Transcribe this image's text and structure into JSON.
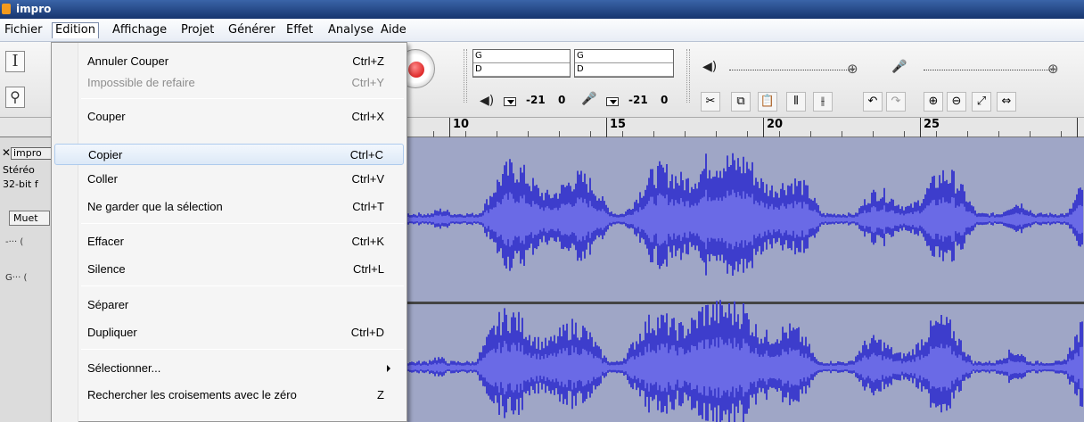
{
  "window": {
    "title": "impro"
  },
  "menubar": {
    "items": [
      "Fichier",
      "Edition",
      "Affichage",
      "Projet",
      "Générer",
      "Effet",
      "Analyse",
      "Aide"
    ],
    "open_menu": "Edition"
  },
  "toolbar": {
    "meter_left_channel": "G",
    "meter_right_channel": "D",
    "playback_meter_scale": [
      "-21",
      "0"
    ],
    "record_meter_scale": [
      "-21",
      "0"
    ]
  },
  "ruler": {
    "labels": [
      "10",
      "15",
      "20",
      "25"
    ]
  },
  "track": {
    "name": "impro",
    "type": "Stéréo",
    "format": "32-bit f",
    "mute_label": "Muet",
    "pan_label": "G"
  },
  "edit_menu": {
    "items": [
      {
        "label": "Annuler Couper",
        "shortcut": "Ctrl+Z",
        "enabled": true
      },
      {
        "label": "Impossible de refaire",
        "shortcut": "Ctrl+Y",
        "enabled": false
      },
      {
        "label": "Couper",
        "shortcut": "Ctrl+X",
        "enabled": true
      },
      {
        "label": "Copier",
        "shortcut": "Ctrl+C",
        "enabled": true,
        "highlighted": true
      },
      {
        "label": "Coller",
        "shortcut": "Ctrl+V",
        "enabled": true
      },
      {
        "label": "Ne garder que la sélection",
        "shortcut": "Ctrl+T",
        "enabled": true
      },
      {
        "label": "Effacer",
        "shortcut": "Ctrl+K",
        "enabled": true
      },
      {
        "label": "Silence",
        "shortcut": "Ctrl+L",
        "enabled": true
      },
      {
        "label": "Séparer",
        "shortcut": "",
        "enabled": true
      },
      {
        "label": "Dupliquer",
        "shortcut": "Ctrl+D",
        "enabled": true
      },
      {
        "label": "Sélectionner...",
        "shortcut": "",
        "enabled": true,
        "submenu": true
      },
      {
        "label": "Rechercher les croisements avec le zéro",
        "shortcut": "Z",
        "enabled": true
      }
    ]
  },
  "colors": {
    "waveform": "#3d3dcc",
    "waveform_rms": "#6a6ae6",
    "track_background": "#9fa6c6",
    "menu_highlight": "#dde9f7"
  }
}
